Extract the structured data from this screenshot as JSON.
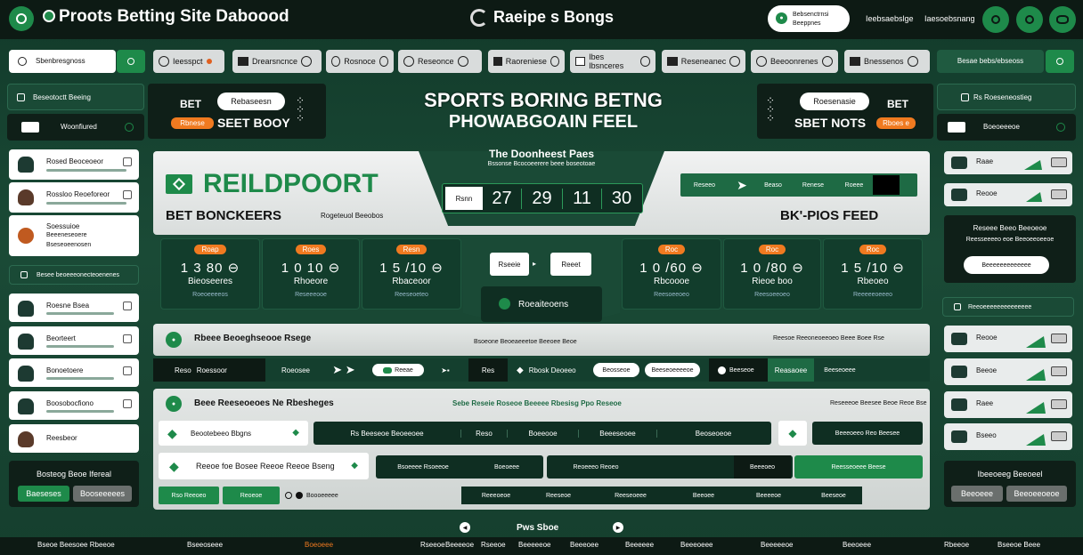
{
  "header": {
    "title": "Proots Betting Site Daboood",
    "center_title": "Raeipe s Bongs",
    "search_top": "Bebsenctrnsi",
    "search_bottom": "Beeppnes",
    "link1": "Ieebsaebslge",
    "link2": "Iaesoebsnang"
  },
  "subnav": {
    "search_label": "Sbenbresgnoss",
    "items": [
      "Ieesspct",
      "Drearsncnce",
      "Rosnoce",
      "Reseonce",
      "Raoreniese",
      "Ibes Ibsnceres",
      "Reseneanec",
      "Beeoonrenes",
      "Bnessenos"
    ],
    "right_label": "Besae bebs/ebseoss"
  },
  "left_panel": {
    "top_item": "Beseotoctt Beeing",
    "selected_item": "Woonfiured",
    "contacts_top": [
      {
        "name": "Rosed Beoceoeor",
        "type": "hood"
      },
      {
        "name": "Rossloo Reoeforeor",
        "type": "person"
      },
      {
        "name": "Soessuioe",
        "line2": "Beeeneseoere",
        "line3": "Bseseoeenosen",
        "type": "ball"
      }
    ],
    "section": "Besee beoeeeonecteoenenes",
    "contacts_bottom": [
      {
        "name": "Roesne Bsea",
        "type": "hood"
      },
      {
        "name": "Beorteert",
        "type": "hood"
      },
      {
        "name": "Bonoetoere",
        "type": "hood"
      },
      {
        "name": "Boosobocfiono",
        "type": "hood"
      },
      {
        "name": "Reesbeor",
        "type": "person"
      }
    ],
    "footer_title": "Bosteog Beoe Ifereal",
    "footer_btn1": "Baeseses",
    "footer_btn2": "Booseeeees"
  },
  "banner": {
    "left_small1": "BET",
    "left_pill": "Rebaseesn",
    "left_orange": "Rbnese",
    "left_big": "SEET BOOY",
    "headline1": "SPORTS BORING BETNG",
    "headline2": "PHOWABGOAIN FEEL",
    "right_small1": "BET",
    "right_pill": "Roesenasie",
    "right_big": "SBET NOTS",
    "right_orange": "Rboes e"
  },
  "hero": {
    "logo": "REILDPOORT",
    "left_caption": "BET BONCKEERS",
    "left_sub": "Rogeteuol Beeobos",
    "center_title": "The Doonheest Paes",
    "center_sub": "Bssonse Bcocoeerere beee boseotoae",
    "score_label": "Rsnn",
    "scores": [
      "27",
      "29",
      "11",
      "30"
    ],
    "right_tabs": [
      "Reseeo",
      "Beaso",
      "Renese",
      "Roeee"
    ],
    "right_caption": "BK'-PIOS FEED"
  },
  "tiles_left": [
    {
      "tag": "Roap",
      "score": "1  3 80  ⊖",
      "name": "Bieoseeres",
      "sub": "Roeoeeeeos"
    },
    {
      "tag": "Roes",
      "score": "1  0  10  ⊖",
      "name": "Rhoeore",
      "sub": "Reseeeooe"
    },
    {
      "tag": "Resn",
      "score": "1  5 /10  ⊖",
      "name": "Rbaceoor",
      "sub": "Reeseoeteo"
    }
  ],
  "tiles_right": [
    {
      "tag": "Roc",
      "score": "1  0 /60  ⊖",
      "name": "Rbcoooe",
      "sub": "Reesoeeoeo"
    },
    {
      "tag": "Roc",
      "score": "1  0 /80  ⊖",
      "name": "Rieoe boo",
      "sub": "Reesoeeoeo"
    },
    {
      "tag": "Roc",
      "score": "1  5 /10  ⊖",
      "name": "Rbeoeo",
      "sub": "Reeeeeoeeeo"
    }
  ],
  "center_controls": {
    "btn1": "Rseeie",
    "btn2": "Reeet",
    "pill": "Roeaiteoens"
  },
  "band": {
    "title": "Rbeee Beoeghseooe Rsege",
    "center_text": "Bsoeone Beoeaeeetoe Beeoee Beoe",
    "right_text": "Reesoe Reeoneoeeoeo Beee Boee Rse"
  },
  "actionbar": {
    "items": [
      "Reso",
      "Roessoor",
      "Roeosee"
    ],
    "pill1": "Reeae",
    "mid": "Res",
    "pill2": "Rbosk Deoeeo",
    "pill3": "Beosseoe",
    "pill4": "Beeseoeeeeoe",
    "right1": "Beeseoe",
    "right2": "Reasaoee",
    "right3": "Beeseoeee"
  },
  "lower": {
    "title": "Beee Reeseoeoes Ne Rbesheges",
    "center": "Sebe Reseie Roseoe Beeeee Rbesisg Ppo Reseoe",
    "right": "Reseeeoe Beesee Beoe Reoe Bse",
    "card1": "Beootebeeo Bbgns",
    "card2": "Reeoe foe Bosee Reeoe Reeoe Bseng",
    "row1": [
      "Rs Beeseoe Beoeeoee",
      "Reso",
      "Boeeooe",
      "Beeeseoee",
      "Beoseoeoe"
    ],
    "row1_right": "Beeeoeeo Reo Beesee",
    "row2": [
      "Bsoeeee Rsoeeoe",
      "Boeoeee",
      "Reoeeeo Reoeo",
      "Beeeoeo",
      "Reesseoeee Beese"
    ],
    "row3": [
      "Rso Reeoeo",
      "Reoeoe",
      "Boooeeeee",
      "Reeeoeoe",
      "Reeseoe",
      "Reeseoeee",
      "Beeoee",
      "Beeeeoe",
      "Beeseoe"
    ]
  },
  "right_panel": {
    "top_item": "Rs Roeseneostieg",
    "selected_item": "Boeoeeeoe",
    "spark_top": [
      "Raae",
      "Reooe"
    ],
    "promo_title": "Reseee Beeo Beeoeoe",
    "promo_sub": "Reesseeeeo eoe Beeoeeoeeoe",
    "promo_btn": "Beeeeeeeeeeeee",
    "section": "Reeoeeeeeeeeeeeeee",
    "spark_bottom": [
      "Reooe",
      "Beeoe",
      "Raee",
      "Bseeo"
    ],
    "footer_title": "Ibeeoeeg Beeoeel",
    "footer_btn1": "Beeoeee",
    "footer_btn2": "Beeoeeoeoe"
  },
  "pager": {
    "label": "Pws Sboe"
  },
  "footer": [
    "Bseoe Beesoee Rbeeoe",
    "Bseeoseee",
    "Boeoeee",
    "Rseeoe",
    "Beeeeoe",
    "Rseeoe",
    "Beeeeeoe",
    "Beeeoee",
    "Beeeeee",
    "Beeeoeee",
    "Beeeeeoe",
    "Beeoeee",
    "Rbeeoe",
    "Bseeoe Beee"
  ]
}
